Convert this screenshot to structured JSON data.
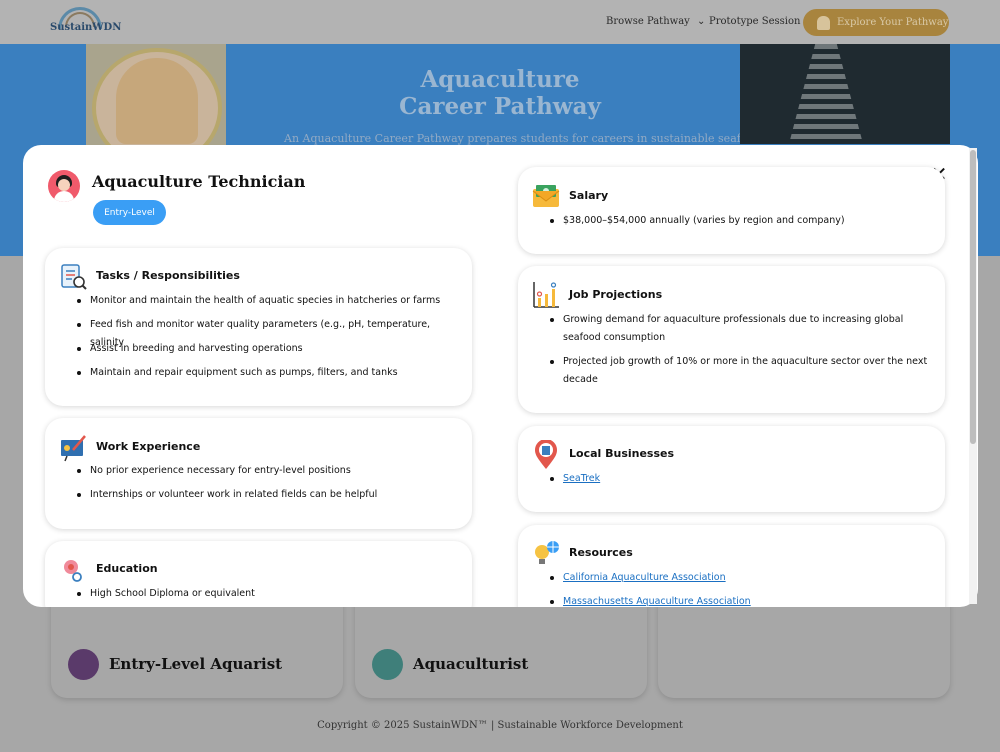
{
  "header": {
    "logo_text": "SustainWDN",
    "nav": {
      "browse": "Browse Pathway",
      "browse_caret": "⌄",
      "prototype": "Prototype Session"
    },
    "cta_label": "Explore Your Pathway"
  },
  "hero": {
    "title_line1": "Aquaculture",
    "title_line2": "Career Pathway",
    "subtitle": "An Aquaculture Career Pathway prepares students for careers in sustainable seafood"
  },
  "background_cards": [
    {
      "title": "Entry-Level Aquarist"
    },
    {
      "title": "Aquaculturist"
    }
  ],
  "footer": {
    "text": "Copyright © 2025 SustainWDN™ | Sustainable Workforce Development"
  },
  "modal": {
    "close_label": "✕",
    "job_title": "Aquaculture Technician",
    "level": "Entry-Level",
    "tasks": {
      "heading": "Tasks / Responsibilities",
      "items": [
        "Monitor and maintain the health of aquatic species in hatcheries or farms",
        "Feed fish and monitor water quality parameters (e.g., pH, temperature, salinity",
        "Assist in breeding and harvesting operations",
        "Maintain and repair equipment such as pumps, filters, and tanks"
      ]
    },
    "work": {
      "heading": "Work Experience",
      "items": [
        "No prior experience necessary for entry-level positions",
        "Internships or volunteer work in related fields can be helpful"
      ]
    },
    "education": {
      "heading": "Education",
      "items": [
        "High School Diploma or equivalent"
      ]
    },
    "salary": {
      "heading": "Salary",
      "items": [
        "$38,000–$54,000 annually (varies by region and company)"
      ]
    },
    "projections": {
      "heading": "Job Projections",
      "items": [
        "Growing demand for aquaculture professionals due to increasing global seafood consumption",
        "Projected job growth of 10% or more in the aquaculture sector over the next decade"
      ]
    },
    "local": {
      "heading": "Local Businesses",
      "items": [
        "SeaTrek"
      ]
    },
    "resources": {
      "heading": "Resources",
      "items": [
        "California Aquaculture Association",
        "Massachusetts Aquaculture Association"
      ]
    }
  },
  "colors": {
    "accent_blue": "#3a9ef5",
    "link_blue": "#1a6fc2",
    "avatar_pink": "#f05a6b"
  }
}
